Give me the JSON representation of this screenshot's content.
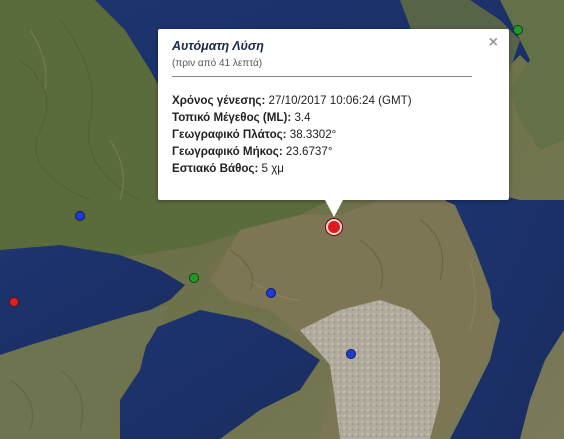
{
  "map": {
    "type": "satellite",
    "markers": [
      {
        "name": "marker-green-ne",
        "color": "#1f9a2a"
      },
      {
        "name": "marker-blue-west",
        "color": "#1f3ad8"
      },
      {
        "name": "marker-green-center",
        "color": "#1f9a2a"
      },
      {
        "name": "marker-red-far-west",
        "color": "#e02020"
      },
      {
        "name": "marker-blue-center",
        "color": "#1f3ad8"
      },
      {
        "name": "marker-blue-south",
        "color": "#1f3ad8"
      },
      {
        "name": "marker-red-selected",
        "color": "#e21a1a"
      }
    ]
  },
  "popup": {
    "title": "Αυτόματη Λύση",
    "subtitle": "(πριν από 41 λεπτά)",
    "close_symbol": "×",
    "fields": {
      "origin_time_label": "Χρόνος γένεσης:",
      "origin_time_value": " 27/10/2017  10:06:24 (GMT)",
      "magnitude_label": "Τοπικό Μέγεθος (ML):",
      "magnitude_value": " 3.4",
      "latitude_label": "Γεωγραφικό Πλάτος:",
      "latitude_value": " 38.3302°",
      "longitude_label": "Γεωγραφικό Μήκος:",
      "longitude_value": " 23.6737°",
      "depth_label": "Εστιακό Βάθος:",
      "depth_value": " 5 χμ"
    }
  }
}
